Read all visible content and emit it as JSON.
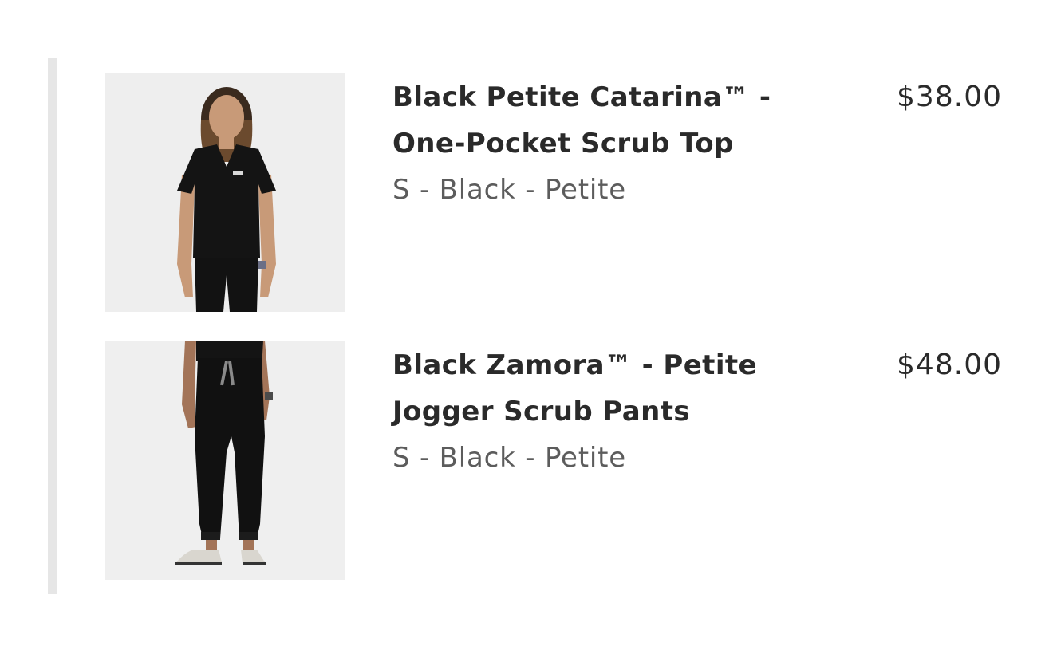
{
  "cart": {
    "items": [
      {
        "title": "Black Petite Catarina™ -\nOne-Pocket Scrub Top",
        "variant": "S - Black - Petite",
        "price": "$38.00",
        "image_icon": "scrub-top-product-image"
      },
      {
        "title": "Black Zamora™ - Petite\nJogger Scrub Pants",
        "variant": "S - Black - Petite",
        "price": "$48.00",
        "image_icon": "scrub-pants-product-image"
      }
    ]
  },
  "colors": {
    "rail": "#e6e6e6",
    "title": "#2a2a2a",
    "variant": "#5c5c5c",
    "garment": "#111111"
  }
}
